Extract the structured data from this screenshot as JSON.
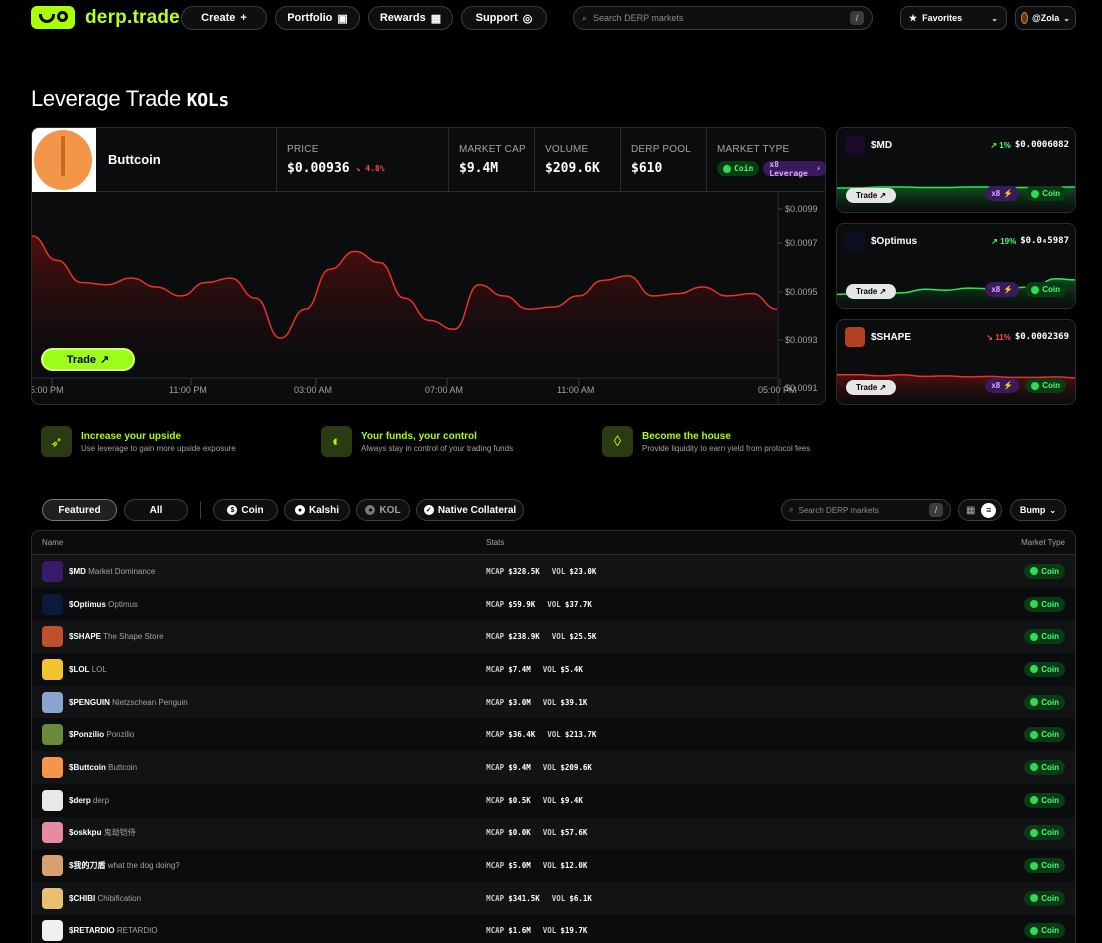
{
  "brand": {
    "name": "derp.trade",
    "accent": "#aaff00"
  },
  "nav": {
    "create": "Create",
    "portfolio": "Portfolio",
    "rewards": "Rewards",
    "support": "Support"
  },
  "search": {
    "placeholder": "Search DERP markets",
    "shortcut": "/"
  },
  "favorites": {
    "label": "Favorites"
  },
  "user": {
    "handle": "@Zola"
  },
  "page": {
    "title": "Leverage Trade",
    "title_badge": "KOLs"
  },
  "featured_market": {
    "name": "Buttcoin",
    "price_label": "PRICE",
    "price": "$0.00936",
    "change": "4.8%",
    "mcap_label": "MARKET CAP",
    "mcap": "$9.4M",
    "volume_label": "VOLUME",
    "volume": "$209.6K",
    "pool_label": "DERP POOL",
    "pool": "$610",
    "type_label": "MARKET TYPE",
    "type_coin": "Coin",
    "type_leverage": "x8 Leverage",
    "trade_label": "Trade"
  },
  "chart_data": {
    "type": "area",
    "title": "",
    "x_tick_labels": [
      "5:00 PM",
      "11:00 PM",
      "03:00 AM",
      "07:00 AM",
      "11:00 AM",
      "05:00 PM"
    ],
    "y_tick_labels": [
      "$0.0099",
      "$0.0097",
      "$0.0095",
      "$0.0093",
      "$0.0091"
    ],
    "ylim": [
      0.0091,
      0.0099
    ],
    "series": [
      {
        "values": [
          0.00973,
          0.00962,
          0.00952,
          0.00951,
          0.00954,
          0.0095,
          0.00946,
          0.00952,
          0.00954,
          0.00945,
          0.00927,
          0.0094,
          0.00958,
          0.00966,
          0.00961,
          0.00945,
          0.00935,
          0.00931,
          0.00951,
          0.00946,
          0.0094,
          0.00941,
          0.00946,
          0.00953,
          0.00955,
          0.00946,
          0.00947,
          0.0095,
          0.00946,
          0.00947,
          0.0094
        ],
        "color": "#e8322b"
      }
    ]
  },
  "side_markets": [
    {
      "ticker": "$MD",
      "change": "1%",
      "direction": "up",
      "price": "$0.0006082",
      "trade": "Trade",
      "leverage": "x8",
      "type": "Coin",
      "color": "#2ee65a",
      "series": [
        0.5,
        0.5,
        0.52,
        0.52,
        0.51,
        0.51,
        0.52,
        0.52,
        0.51,
        0.51,
        0.52,
        0.52
      ]
    },
    {
      "ticker": "$Optimus",
      "change": "19%",
      "direction": "up",
      "price": "$0.0₄5987",
      "trade": "Trade",
      "leverage": "x8",
      "type": "Coin",
      "color": "#2ee65a",
      "series": [
        0.3,
        0.32,
        0.31,
        0.33,
        0.4,
        0.38,
        0.42,
        0.41,
        0.43,
        0.44,
        0.6,
        0.58
      ]
    },
    {
      "ticker": "$SHAPE",
      "change": "11%",
      "direction": "down",
      "price": "$0.0002369",
      "trade": "Trade",
      "leverage": "x8",
      "type": "Coin",
      "color": "#e8322b",
      "series": [
        0.6,
        0.6,
        0.58,
        0.6,
        0.57,
        0.58,
        0.56,
        0.57,
        0.55,
        0.55,
        0.56,
        0.54
      ]
    }
  ],
  "features": [
    {
      "title": "Increase your upside",
      "sub": "Use leverage to gain more upside exposure",
      "icon": "rocket-icon"
    },
    {
      "title": "Your funds, your control",
      "sub": "Always stay in control of your trading funds",
      "icon": "shield-icon"
    },
    {
      "title": "Become the house",
      "sub": "Provide liquidity to earn yield from protocol fees",
      "icon": "drop-icon"
    }
  ],
  "filters": {
    "featured": "Featured",
    "all": "All",
    "coin": "Coin",
    "kalshi": "Kalshi",
    "kol": "KOL",
    "native": "Native Collateral"
  },
  "list_search": {
    "placeholder": "Search DERP markets",
    "shortcut": "/"
  },
  "sort": {
    "label": "Bump"
  },
  "table": {
    "headers": {
      "name": "Name",
      "stats": "Stats",
      "type": "Market Type"
    },
    "mcap_key": "MCAP",
    "vol_key": "VOL",
    "rows": [
      {
        "ticker": "$MD",
        "name": "Market Dominance",
        "mcap": "$328.5K",
        "vol": "$23.0K",
        "type": "Coin",
        "color": "#3a1a6a"
      },
      {
        "ticker": "$Optimus",
        "name": "Optimus",
        "mcap": "$59.9K",
        "vol": "$37.7K",
        "type": "Coin",
        "color": "#0a1a3a"
      },
      {
        "ticker": "$SHAPE",
        "name": "The Shape Store",
        "mcap": "$238.9K",
        "vol": "$25.5K",
        "type": "Coin",
        "color": "#c0502a"
      },
      {
        "ticker": "$LOL",
        "name": "LOL",
        "mcap": "$7.4M",
        "vol": "$5.4K",
        "type": "Coin",
        "color": "#f4c430"
      },
      {
        "ticker": "$PENGUIN",
        "name": "Nietzschean Penguin",
        "mcap": "$3.0M",
        "vol": "$39.1K",
        "type": "Coin",
        "color": "#8aa6d0"
      },
      {
        "ticker": "$Ponzilio",
        "name": "Ponzilio",
        "mcap": "$36.4K",
        "vol": "$213.7K",
        "type": "Coin",
        "color": "#6a8a3a"
      },
      {
        "ticker": "$Buttcoin",
        "name": "Buttcoin",
        "mcap": "$9.4M",
        "vol": "$209.6K",
        "type": "Coin",
        "color": "#f4964a"
      },
      {
        "ticker": "$derp",
        "name": "derp",
        "mcap": "$0.5K",
        "vol": "$9.4K",
        "type": "Coin",
        "color": "#e8e8e8"
      },
      {
        "ticker": "$oskkpu",
        "name": "鬼劫铠侍",
        "mcap": "$0.0K",
        "vol": "$57.6K",
        "type": "Coin",
        "color": "#e88aa0"
      },
      {
        "ticker": "$我的刀盾",
        "name": "what the dog doing?",
        "mcap": "$5.0M",
        "vol": "$12.0K",
        "type": "Coin",
        "color": "#d8a070"
      },
      {
        "ticker": "$CHIBI",
        "name": "Chibification",
        "mcap": "$341.5K",
        "vol": "$6.1K",
        "type": "Coin",
        "color": "#e8c070"
      },
      {
        "ticker": "$RETARDIO",
        "name": "RETARDIO",
        "mcap": "$1.6M",
        "vol": "$19.7K",
        "type": "Coin",
        "color": "#f0f0f0"
      }
    ]
  }
}
